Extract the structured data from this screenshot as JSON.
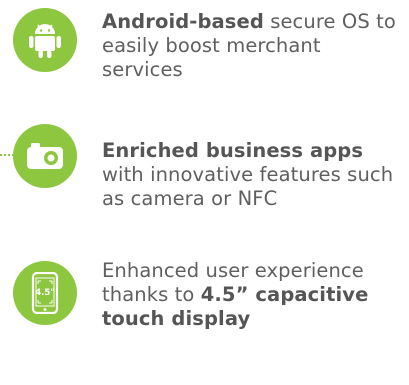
{
  "colors": {
    "accent": "#8dc63f",
    "text": "#5f5f5f"
  },
  "features": [
    {
      "icon": "android-icon",
      "bold": "Android-based",
      "rest": " secure OS to easily boost merchant services"
    },
    {
      "icon": "camera-icon",
      "bold": "Enriched business apps",
      "rest": " with innovative features such as camera or NFC"
    },
    {
      "icon": "phone-screen-icon",
      "screen_label": "4.5\"",
      "pre": "Enhanced user experience thanks to ",
      "bold": "4.5” capacitive touch display"
    }
  ]
}
